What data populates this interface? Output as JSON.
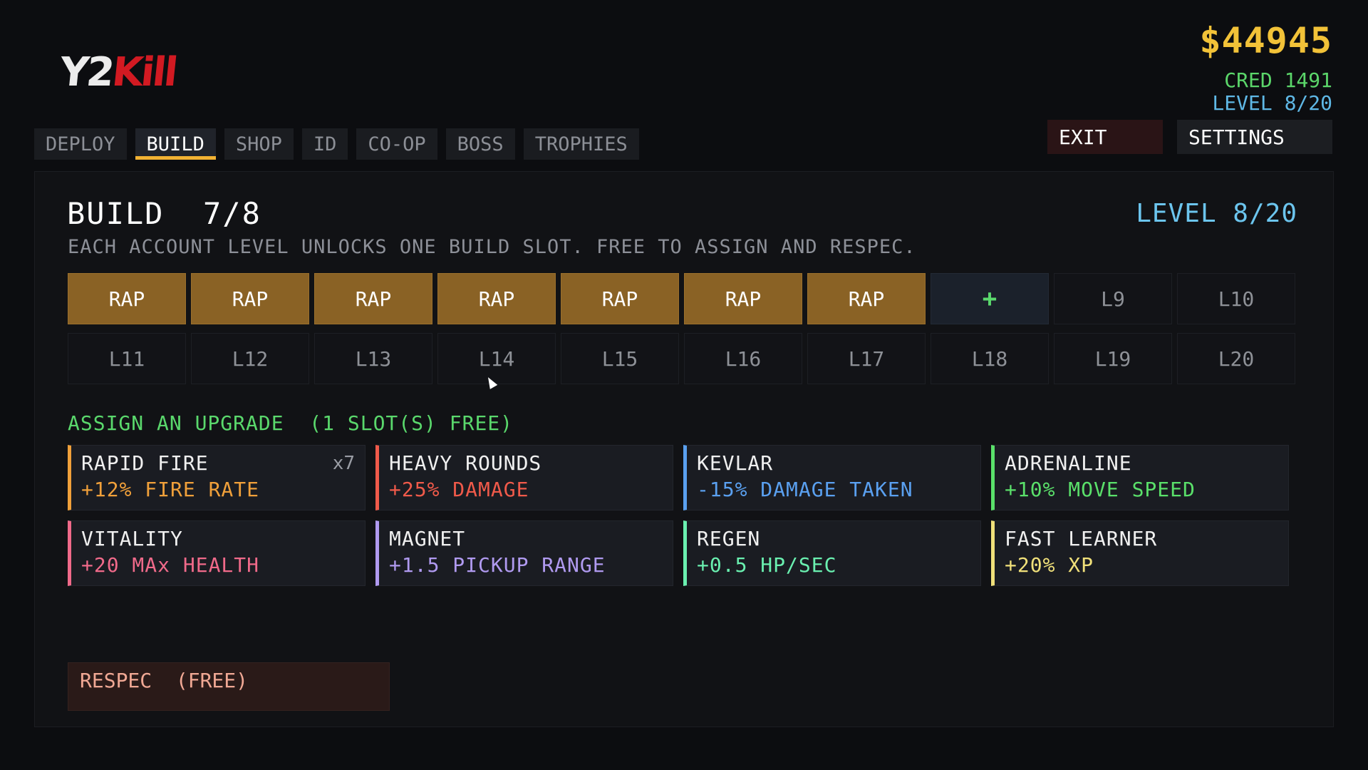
{
  "logo": {
    "part1": "Y2",
    "part2": "Kill"
  },
  "hud": {
    "money": "$44945",
    "cred": "CRED 1491",
    "level": "LEVEL 8/20"
  },
  "tabs": [
    {
      "label": "DEPLOY",
      "active": false
    },
    {
      "label": "BUILD",
      "active": true
    },
    {
      "label": "SHOP",
      "active": false
    },
    {
      "label": "ID",
      "active": false
    },
    {
      "label": "CO-OP",
      "active": false
    },
    {
      "label": "BOSS",
      "active": false
    },
    {
      "label": "TROPHIES",
      "active": false
    }
  ],
  "buttons": {
    "exit": "EXIT",
    "settings": "SETTINGS"
  },
  "panel": {
    "title": "BUILD  7/8",
    "level": "LEVEL 8/20",
    "subtitle": "EACH ACCOUNT LEVEL UNLOCKS ONE BUILD SLOT. FREE TO ASSIGN AND RESPEC.",
    "slots": [
      {
        "label": "RAP",
        "state": "filled"
      },
      {
        "label": "RAP",
        "state": "filled"
      },
      {
        "label": "RAP",
        "state": "filled"
      },
      {
        "label": "RAP",
        "state": "filled"
      },
      {
        "label": "RAP",
        "state": "filled"
      },
      {
        "label": "RAP",
        "state": "filled"
      },
      {
        "label": "RAP",
        "state": "filled"
      },
      {
        "label": "+",
        "state": "add"
      },
      {
        "label": "L9",
        "state": "locked"
      },
      {
        "label": "L10",
        "state": "locked"
      },
      {
        "label": "L11",
        "state": "locked"
      },
      {
        "label": "L12",
        "state": "locked"
      },
      {
        "label": "L13",
        "state": "locked"
      },
      {
        "label": "L14",
        "state": "locked"
      },
      {
        "label": "L15",
        "state": "locked"
      },
      {
        "label": "L16",
        "state": "locked"
      },
      {
        "label": "L17",
        "state": "locked"
      },
      {
        "label": "L18",
        "state": "locked"
      },
      {
        "label": "L19",
        "state": "locked"
      },
      {
        "label": "L20",
        "state": "locked"
      }
    ],
    "assign_label": "ASSIGN AN UPGRADE  (1 SLOT(S) FREE)",
    "upgrades": [
      {
        "id": "rapid-fire",
        "name": "RAPID FIRE",
        "desc": "+12% FIRE RATE",
        "count": "x7",
        "color": "#f0a03a"
      },
      {
        "id": "heavy-rounds",
        "name": "HEAVY ROUNDS",
        "desc": "+25% DAMAGE",
        "count": "",
        "color": "#f05a4a"
      },
      {
        "id": "kevlar",
        "name": "KEVLAR",
        "desc": "-15% DAMAGE TAKEN",
        "count": "",
        "color": "#5aa0f0"
      },
      {
        "id": "adrenaline",
        "name": "ADRENALINE",
        "desc": "+10% MOVE SPEED",
        "count": "",
        "color": "#5ae06a"
      },
      {
        "id": "vitality",
        "name": "VITALITY",
        "desc": "+20 MAx HEALTH",
        "count": "",
        "color": "#f06a8a"
      },
      {
        "id": "magnet",
        "name": "MAGNET",
        "desc": "+1.5 PICKUP RANGE",
        "count": "",
        "color": "#b09af0"
      },
      {
        "id": "regen",
        "name": "REGEN",
        "desc": "+0.5 HP/SEC",
        "count": "",
        "color": "#6af0b0"
      },
      {
        "id": "fast-learner",
        "name": "FAST LEARNER",
        "desc": "+20% XP",
        "count": "",
        "color": "#f0e07a"
      }
    ],
    "respec": "RESPEC  (FREE)"
  }
}
